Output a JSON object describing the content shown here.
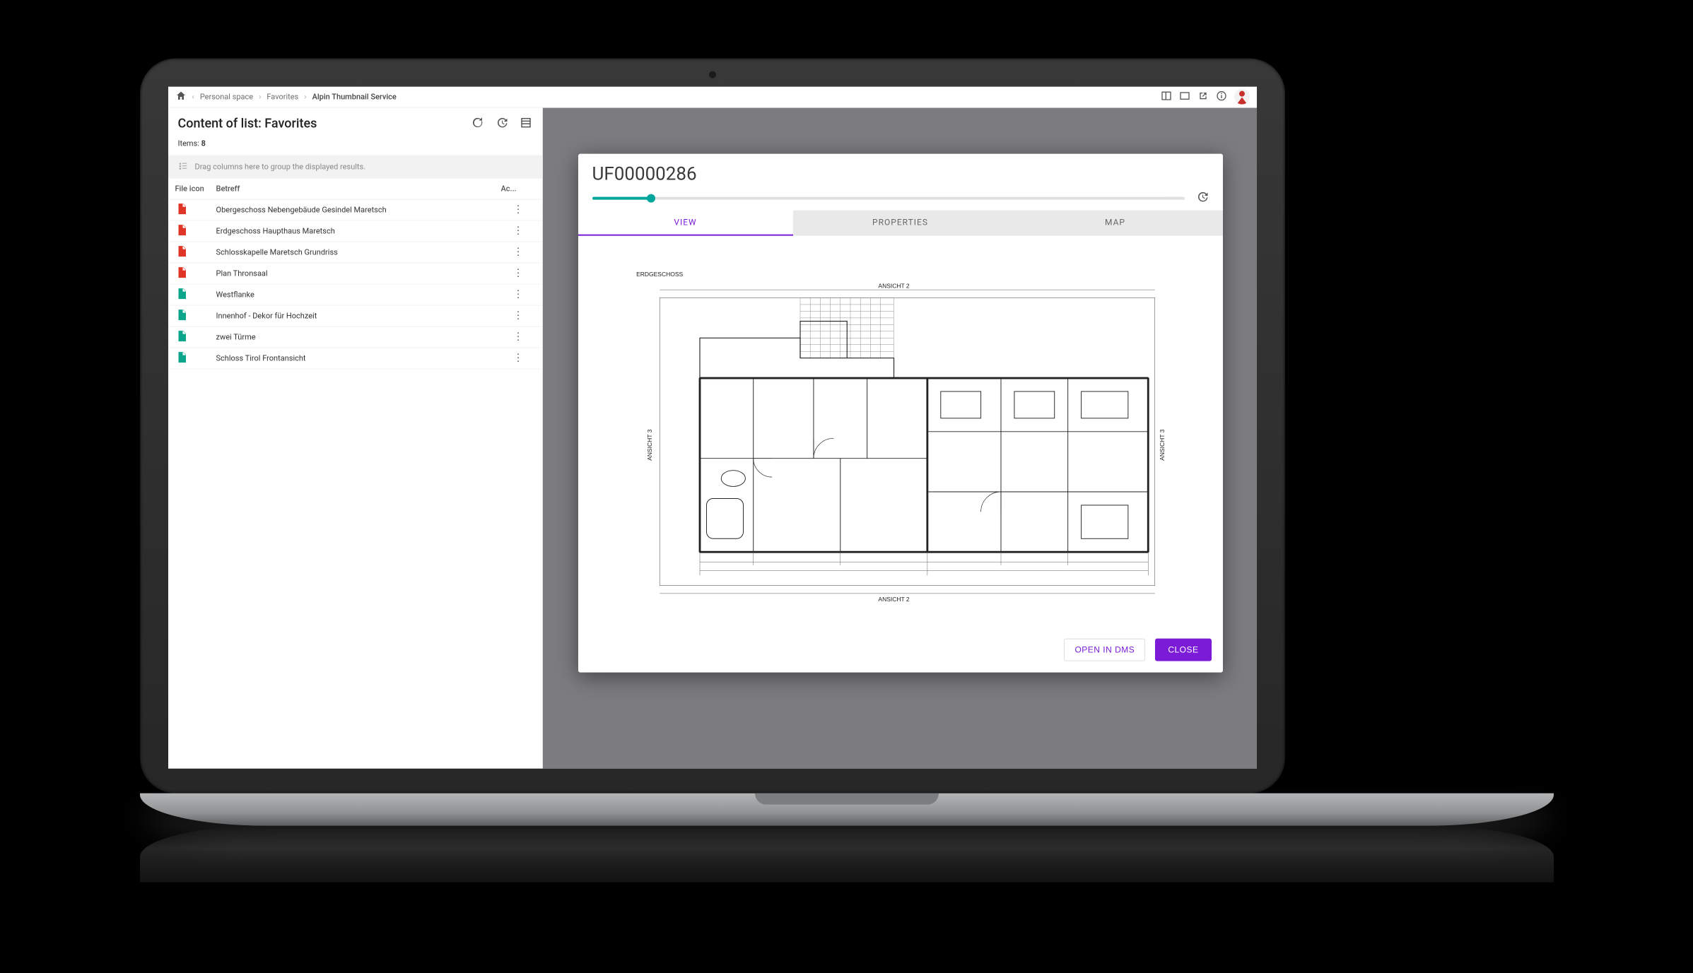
{
  "breadcrumbs": {
    "items": [
      "Personal space",
      "Favorites",
      "Alpin Thumbnail Service"
    ]
  },
  "leftPanel": {
    "title": "Content of list: Favorites",
    "itemsLabel": "Items:",
    "itemsCount": "8",
    "groupHint": "Drag columns here to group the displayed results.",
    "columns": {
      "icon": "File icon",
      "subject": "Betreff",
      "actions": "Ac..."
    },
    "rows": [
      {
        "type": "pdf",
        "subject": "Obergeschoss Nebengebäude Gesindel Maretsch"
      },
      {
        "type": "pdf",
        "subject": "Erdgeschoss Haupthaus Maretsch"
      },
      {
        "type": "pdf",
        "subject": "Schlosskapelle Maretsch Grundriss"
      },
      {
        "type": "pdf",
        "subject": "Plan Thronsaal"
      },
      {
        "type": "doc",
        "subject": "Westflanke"
      },
      {
        "type": "doc",
        "subject": "Innenhof - Dekor für Hochzeit"
      },
      {
        "type": "doc",
        "subject": "zwei Türme"
      },
      {
        "type": "doc",
        "subject": "Schloss Tirol Frontansicht"
      }
    ]
  },
  "modal": {
    "title": "UF00000286",
    "tabs": {
      "view": "VIEW",
      "properties": "PROPERTIES",
      "map": "MAP"
    },
    "drawingLabels": {
      "title": "ERDGESCHOSS",
      "ansicht2a": "ANSICHT 2",
      "ansicht2b": "ANSICHT 2",
      "ansicht3l": "ANSICHT 3",
      "ansicht3r": "ANSICHT 3"
    },
    "buttons": {
      "open": "OPEN IN DMS",
      "close": "CLOSE"
    }
  }
}
